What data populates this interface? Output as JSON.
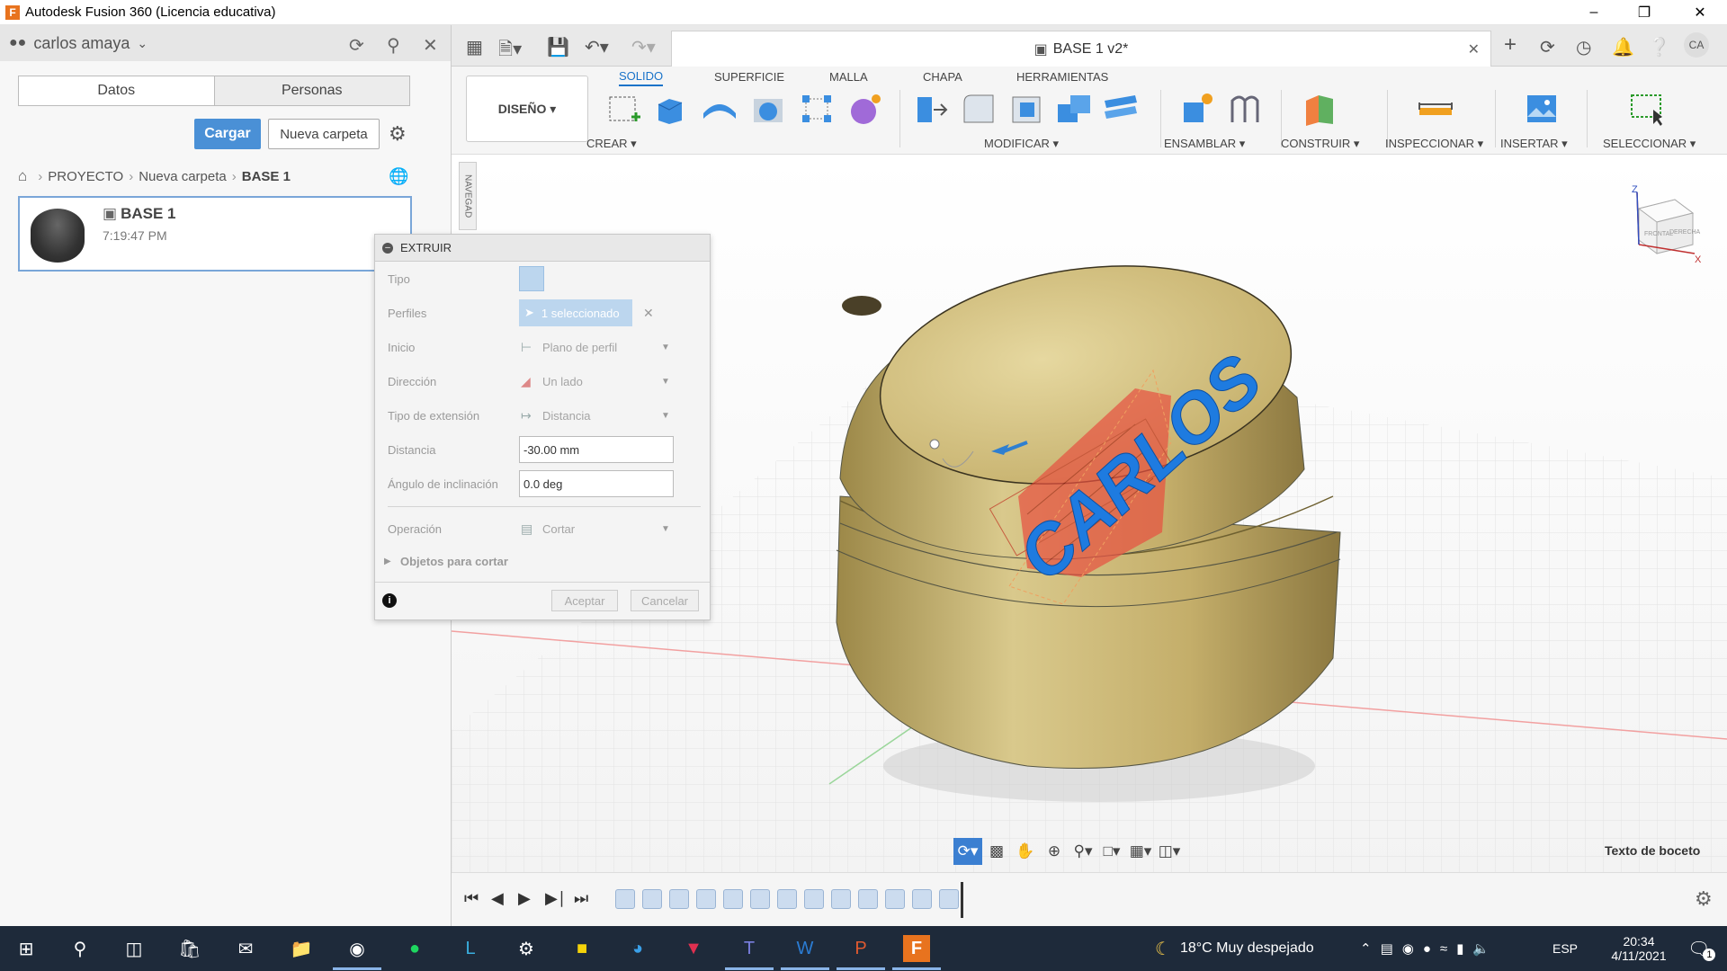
{
  "window": {
    "title": "Autodesk Fusion 360 (Licencia educativa)",
    "app_icon_letter": "F"
  },
  "datapanel": {
    "user": "carlos amaya",
    "tabs": [
      "Datos",
      "Personas"
    ],
    "cargar_label": "Cargar",
    "nueva_carpeta_label": "Nueva carpeta",
    "breadcrumb": [
      "PROYECTO",
      "Nueva carpeta",
      "BASE 1"
    ],
    "file": {
      "name": "BASE 1",
      "time": "7:19:47 PM"
    }
  },
  "document_tab": {
    "title": "BASE 1 v2*"
  },
  "toolbar": {
    "design_label": "DISEÑO ▾",
    "tabs": [
      "SOLIDO",
      "SUPERFICIE",
      "MALLA",
      "CHAPA",
      "HERRAMIENTAS"
    ],
    "active_tab": "SOLIDO",
    "groups": [
      "CREAR ▾",
      "MODIFICAR ▾",
      "ENSAMBLAR ▾",
      "CONSTRUIR ▾",
      "INSPECCIONAR ▾",
      "INSERTAR ▾",
      "SELECCIONAR ▾"
    ]
  },
  "navigator": {
    "label": "NAVEGAD"
  },
  "viewport": {
    "sketch_text": "CARLOS",
    "status_label": "Texto de boceto",
    "viewcube_labels": [
      "FRONTAL",
      "DERECHA"
    ],
    "axis_labels": [
      "Z",
      "X"
    ]
  },
  "extrude": {
    "title": "EXTRUIR",
    "labels": {
      "tipo": "Tipo",
      "perfiles": "Perfiles",
      "inicio": "Inicio",
      "direccion": "Dirección",
      "tipo_extension": "Tipo de extensión",
      "distancia": "Distancia",
      "angulo": "Ángulo de inclinación",
      "operacion": "Operación",
      "objetos": "Objetos para cortar"
    },
    "values": {
      "perfiles": "1 seleccionado",
      "inicio": "Plano de perfil",
      "direccion": "Un lado",
      "tipo_extension": "Distancia",
      "distancia": "-30.00 mm",
      "angulo": "0.0 deg",
      "operacion": "Cortar"
    },
    "aceptar": "Aceptar",
    "cancelar": "Cancelar"
  },
  "taskbar": {
    "weather": "18°C  Muy despejado",
    "lang": "ESP",
    "time": "20:34",
    "date": "4/11/2021",
    "notif_count": "1"
  },
  "colors": {
    "accent": "#1a73c9",
    "body": "#c9b36c",
    "cut": "#e85040",
    "text3d": "#1e7be0"
  }
}
